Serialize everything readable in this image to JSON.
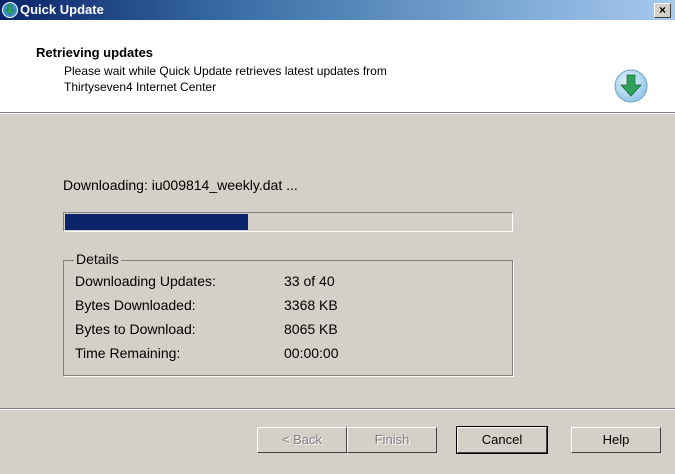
{
  "window": {
    "title": "Quick Update",
    "close_label": "×"
  },
  "header": {
    "title": "Retrieving updates",
    "subtitle_line1": "Please wait while Quick Update retrieves latest updates from",
    "subtitle_line2": "Thirtyseven4 Internet Center"
  },
  "status": {
    "downloading_text": "Downloading: iu009814_weekly.dat ..."
  },
  "progress": {
    "fraction": 0.41
  },
  "details": {
    "legend": "Details",
    "rows": [
      {
        "label": "Downloading Updates:",
        "value": "33 of 40"
      },
      {
        "label": "Bytes Downloaded:",
        "value": "3368 KB"
      },
      {
        "label": "Bytes to Download:",
        "value": "8065 KB"
      },
      {
        "label": "Time Remaining:",
        "value": "00:00:00"
      }
    ]
  },
  "buttons": {
    "back": "< Back",
    "finish": "Finish",
    "cancel": "Cancel",
    "help": "Help"
  },
  "colors": {
    "progress_fill": "#0a246a",
    "dialog_bg": "#d4d0c8",
    "icon_green": "#2fa05a",
    "icon_blue": "#5aa8d8"
  },
  "icons": {
    "app": "quick-update-app-icon",
    "header": "download-arrow-icon"
  }
}
